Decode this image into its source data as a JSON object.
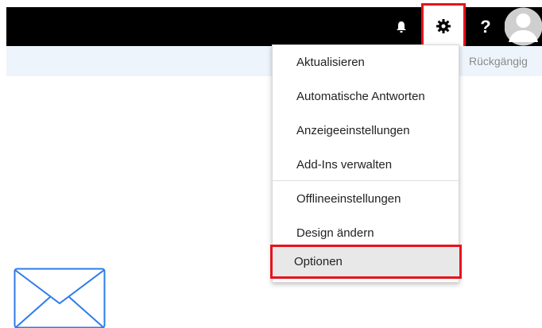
{
  "topbar": {
    "icons": [
      "bell-icon",
      "gear-icon",
      "help-icon",
      "avatar-icon"
    ],
    "help_label": "?"
  },
  "subbar": {
    "undo_label": "Rückgängig"
  },
  "settings_menu": {
    "items": [
      {
        "label": "Aktualisieren"
      },
      {
        "label": "Automatische Antworten"
      },
      {
        "label": "Anzeigeeinstellungen"
      },
      {
        "label": "Add-Ins verwalten"
      },
      {
        "label": "Offlineeinstellungen"
      },
      {
        "label": "Design ändern"
      },
      {
        "label": "Optionen"
      }
    ]
  },
  "colors": {
    "topbar": "#000000",
    "subbar": "#eef4fc",
    "highlight_border": "#e8121c",
    "envelope": "#2b7de9"
  }
}
